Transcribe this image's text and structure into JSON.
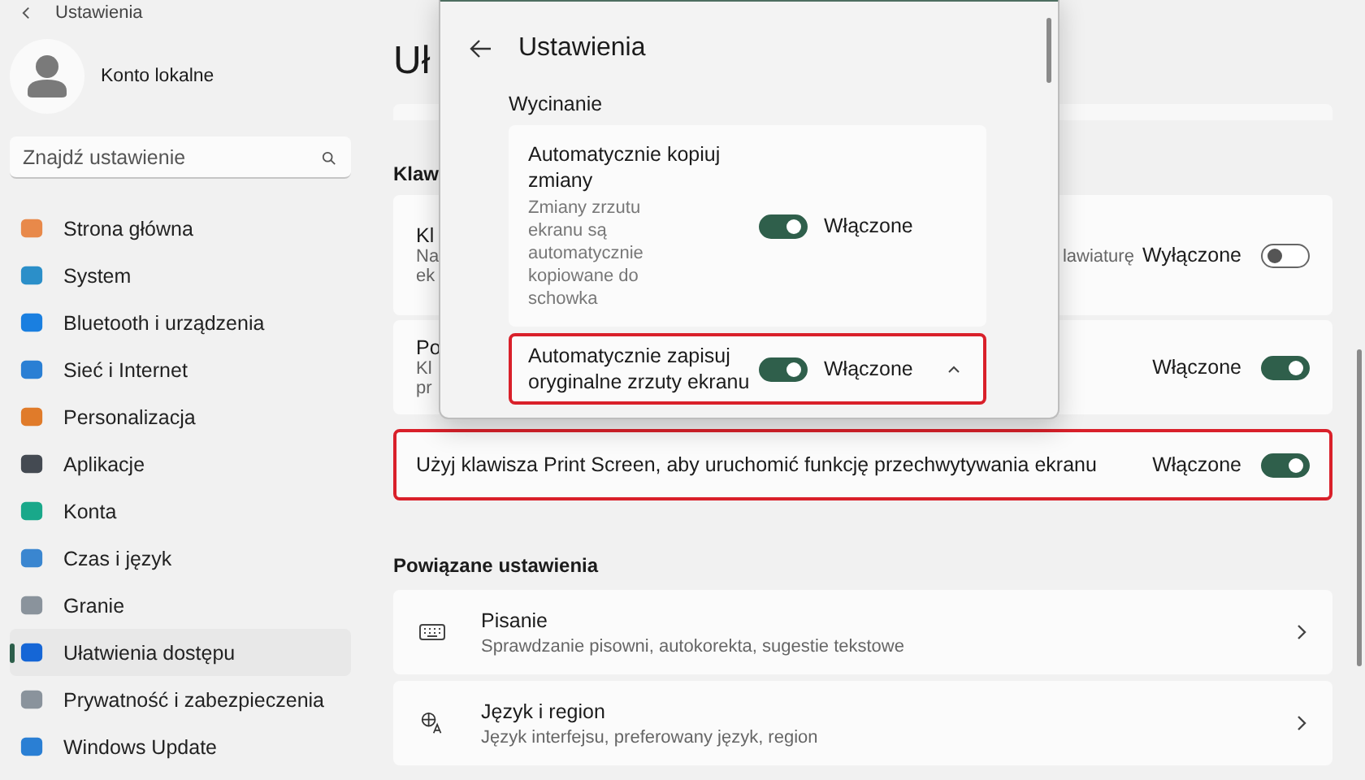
{
  "app_header": {
    "title": "Ustawienia"
  },
  "account": {
    "name": "Konto lokalne"
  },
  "search": {
    "placeholder": "Znajdź ustawienie"
  },
  "sidebar": {
    "items": [
      {
        "label": "Strona główna",
        "selected": false
      },
      {
        "label": "System",
        "selected": false
      },
      {
        "label": "Bluetooth i urządzenia",
        "selected": false
      },
      {
        "label": "Sieć i Internet",
        "selected": false
      },
      {
        "label": "Personalizacja",
        "selected": false
      },
      {
        "label": "Aplikacje",
        "selected": false
      },
      {
        "label": "Konta",
        "selected": false
      },
      {
        "label": "Czas i język",
        "selected": false
      },
      {
        "label": "Granie",
        "selected": false
      },
      {
        "label": "Ułatwienia dostępu",
        "selected": true
      },
      {
        "label": "Prywatność i zabezpieczenia",
        "selected": false
      },
      {
        "label": "Windows Update",
        "selected": false
      }
    ]
  },
  "main": {
    "title": "Uł",
    "section": "Klaw",
    "settings": [
      {
        "title": "Kl",
        "description_lines": [
          "Na",
          "ek"
        ],
        "description_tail": "lawiaturę",
        "status": "Wyłączone",
        "on": false,
        "highlighted": false
      },
      {
        "title": "Po",
        "description_lines": [
          "Kl",
          "pr"
        ],
        "status": "Włączone",
        "on": true,
        "highlighted": false
      },
      {
        "title": "Użyj klawisza Print Screen, aby uruchomić funkcję przechwytywania ekranu",
        "status": "Włączone",
        "on": true,
        "highlighted": true
      }
    ],
    "related": {
      "title": "Powiązane ustawienia",
      "items": [
        {
          "kind": "keyboard",
          "title": "Pisanie",
          "description": "Sprawdzanie pisowni, autokorekta, sugestie tekstowe"
        },
        {
          "kind": "language",
          "title": "Język i region",
          "description": "Język interfejsu, preferowany język, region"
        }
      ]
    }
  },
  "popup": {
    "title": "Ustawienia",
    "section": "Wycinanie",
    "settings": [
      {
        "title": "Automatycznie kopiuj zmiany",
        "description": "Zmiany zrzutu ekranu są automatycznie kopiowane do schowka",
        "status": "Włączone",
        "on": true,
        "highlighted": false,
        "expanded": false
      },
      {
        "title": "Automatycznie zapisuj oryginalne zrzuty ekranu",
        "status": "Włączone",
        "on": true,
        "highlighted": true,
        "expanded": true
      }
    ]
  }
}
